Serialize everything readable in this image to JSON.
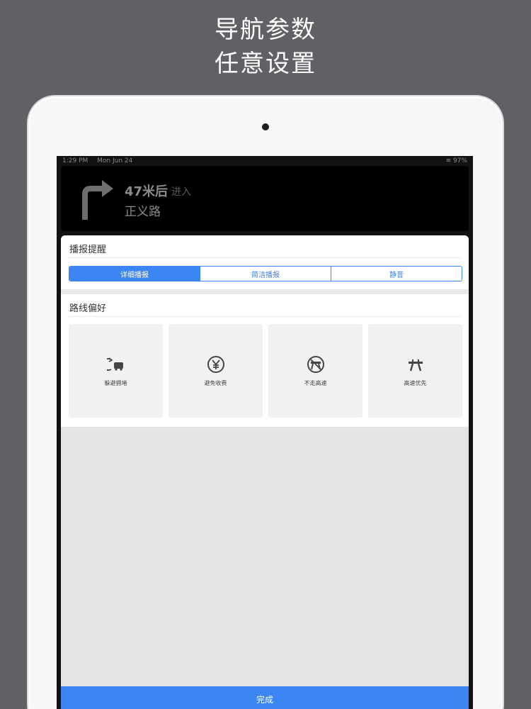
{
  "promo": {
    "line1": "导航参数",
    "line2": "任意设置"
  },
  "status_bar": {
    "time": "1:29 PM",
    "date": "Mon Jun 24",
    "battery": "97%"
  },
  "nav_banner": {
    "distance": "47米后",
    "action": "进入",
    "road": "正义路",
    "maneuver_icon": "turn-right-icon"
  },
  "broadcast": {
    "title": "播报提醒",
    "options": [
      "详细播报",
      "简洁播报",
      "静音"
    ],
    "selected": "详细播报"
  },
  "route_pref": {
    "title": "路线偏好",
    "options": [
      {
        "label": "躲避拥堵",
        "icon": "avoid-congestion-icon"
      },
      {
        "label": "避免收费",
        "icon": "avoid-toll-icon"
      },
      {
        "label": "不走高速",
        "icon": "no-highway-icon"
      },
      {
        "label": "高速优先",
        "icon": "highway-first-icon"
      }
    ]
  },
  "done_label": "完成",
  "colors": {
    "accent": "#3b86f2",
    "background": "#616064"
  }
}
